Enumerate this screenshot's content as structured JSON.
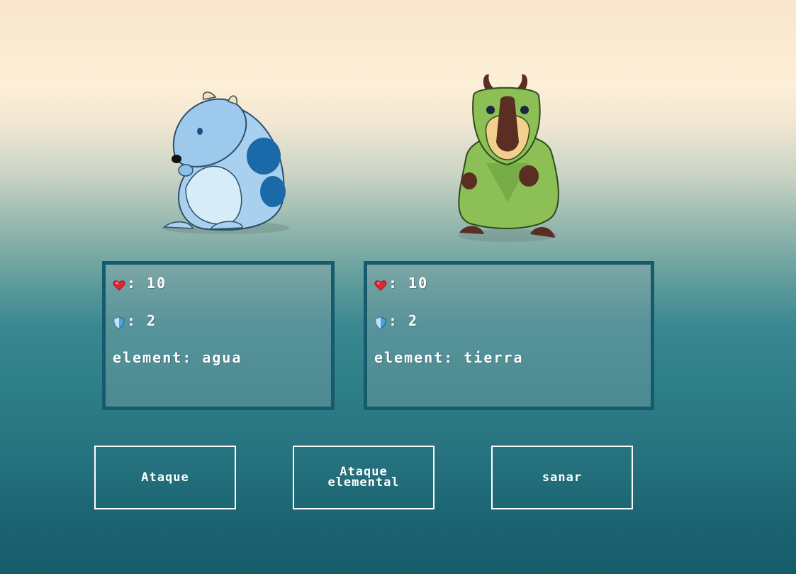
{
  "creatures": {
    "left": {
      "name": "blue-hamster-creature",
      "element_value": "agua"
    },
    "right": {
      "name": "green-capybara-creature",
      "element_value": "tierra"
    }
  },
  "stats": {
    "left": {
      "hp_icon": "heart-icon",
      "hp_sep": ":",
      "hp_value": "10",
      "def_icon": "shield-icon",
      "def_sep": ":",
      "def_value": "2",
      "element_label": "element:",
      "element_value": "agua"
    },
    "right": {
      "hp_icon": "heart-icon",
      "hp_sep": ":",
      "hp_value": "10",
      "def_icon": "shield-icon",
      "def_sep": ":",
      "def_value": "2",
      "element_label": "element:",
      "element_value": "tierra"
    }
  },
  "actions": {
    "attack_label": "Ataque",
    "elemental_label": "Ataque elemental",
    "heal_label": "sanar"
  },
  "colors": {
    "panel_border": "#165b6d",
    "button_border": "#ffffff",
    "heart": "#e32636",
    "shield": "#4aa3df"
  }
}
